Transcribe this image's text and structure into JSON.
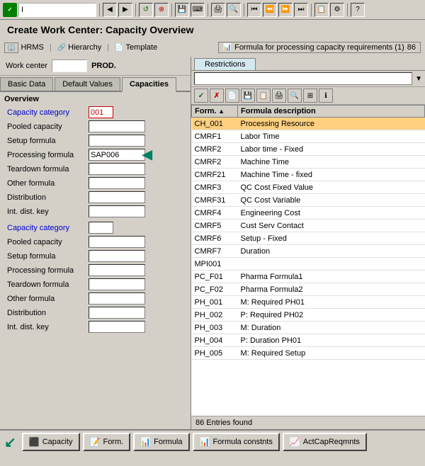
{
  "title": "Create Work Center: Capacity Overview",
  "top_toolbar": {
    "input_value": "I"
  },
  "nav_items": [
    {
      "label": "HRMS",
      "icon": "hrms-icon"
    },
    {
      "label": "Hierarchy",
      "icon": "hierarchy-icon"
    },
    {
      "label": "Template",
      "icon": "template-icon"
    }
  ],
  "formula_panel": {
    "title": "Formula for processing capacity requirements (1)",
    "count": "86",
    "restrictions_tab": "Restrictions"
  },
  "work_center": {
    "label": "Work center",
    "value": "PROD."
  },
  "tabs": [
    {
      "label": "Basic Data",
      "active": false
    },
    {
      "label": "Default Values",
      "active": false
    },
    {
      "label": "Capacities",
      "active": true
    }
  ],
  "overview": {
    "title": "Overview",
    "sections": [
      {
        "fields": [
          {
            "label": "Capacity category",
            "value": "001",
            "type": "red",
            "color": "blue"
          },
          {
            "label": "Pooled capacity",
            "value": "",
            "type": "input",
            "color": "normal"
          },
          {
            "label": "Setup formula",
            "value": "",
            "type": "input",
            "color": "normal"
          },
          {
            "label": "Processing formula",
            "value": "SAP006",
            "type": "input",
            "color": "normal"
          },
          {
            "label": "Teardown formula",
            "value": "",
            "type": "input",
            "color": "normal"
          },
          {
            "label": "Other formula",
            "value": "",
            "type": "input",
            "color": "normal"
          },
          {
            "label": "Distribution",
            "value": "",
            "type": "input",
            "color": "normal"
          },
          {
            "label": "Int. dist. key",
            "value": "",
            "type": "input",
            "color": "normal"
          }
        ]
      },
      {
        "fields": [
          {
            "label": "Capacity category",
            "value": "",
            "type": "input",
            "color": "blue"
          },
          {
            "label": "Pooled capacity",
            "value": "",
            "type": "input",
            "color": "normal"
          },
          {
            "label": "Setup formula",
            "value": "",
            "type": "input",
            "color": "normal"
          },
          {
            "label": "Processing formula",
            "value": "",
            "type": "input",
            "color": "normal"
          },
          {
            "label": "Teardown formula",
            "value": "",
            "type": "input",
            "color": "normal"
          },
          {
            "label": "Other formula",
            "value": "",
            "type": "input",
            "color": "normal"
          },
          {
            "label": "Distribution",
            "value": "",
            "type": "input",
            "color": "normal"
          },
          {
            "label": "Int. dist. key",
            "value": "",
            "type": "input",
            "color": "normal"
          }
        ]
      }
    ]
  },
  "formula_table": {
    "columns": [
      "Form.",
      "Formula description"
    ],
    "rows": [
      {
        "form": "CH_001",
        "desc": "Processing Resource",
        "selected": true
      },
      {
        "form": "CMRF1",
        "desc": "Labor Time",
        "selected": false
      },
      {
        "form": "CMRF2",
        "desc": "Labor time - Fixed",
        "selected": false
      },
      {
        "form": "CMRF2",
        "desc": "Machine Time",
        "selected": false
      },
      {
        "form": "CMRF21",
        "desc": "Machine Time - fixed",
        "selected": false
      },
      {
        "form": "CMRF3",
        "desc": "QC Cost Fixed Value",
        "selected": false
      },
      {
        "form": "CMRF31",
        "desc": "QC Cost Variable",
        "selected": false
      },
      {
        "form": "CMRF4",
        "desc": "Engineering Cost",
        "selected": false
      },
      {
        "form": "CMRF5",
        "desc": "Cust Serv Contact",
        "selected": false
      },
      {
        "form": "CMRF6",
        "desc": "Setup - Fixed",
        "selected": false
      },
      {
        "form": "CMRF7",
        "desc": "Duration",
        "selected": false
      },
      {
        "form": "MPI001",
        "desc": "",
        "selected": false
      },
      {
        "form": "PC_F01",
        "desc": "Pharma Formula1",
        "selected": false
      },
      {
        "form": "PC_F02",
        "desc": "Pharma Formula2",
        "selected": false
      },
      {
        "form": "PH_001",
        "desc": "M: Required PH01",
        "selected": false
      },
      {
        "form": "PH_002",
        "desc": "P: Required PH02",
        "selected": false
      },
      {
        "form": "PH_003",
        "desc": "M: Duration",
        "selected": false
      },
      {
        "form": "PH_004",
        "desc": "P: Duration PH01",
        "selected": false
      },
      {
        "form": "PH_005",
        "desc": "M: Required Setup",
        "selected": false
      }
    ],
    "entries_found": "86 Entries found"
  },
  "bottom_buttons": [
    {
      "label": "Capacity",
      "icon": "capacity-icon"
    },
    {
      "label": "Form.",
      "icon": "form-icon"
    },
    {
      "label": "Formula",
      "icon": "formula-icon"
    },
    {
      "label": "Formula constnts",
      "icon": "formula-const-icon"
    },
    {
      "label": "ActCapReqmnts",
      "icon": "act-cap-icon"
    }
  ]
}
